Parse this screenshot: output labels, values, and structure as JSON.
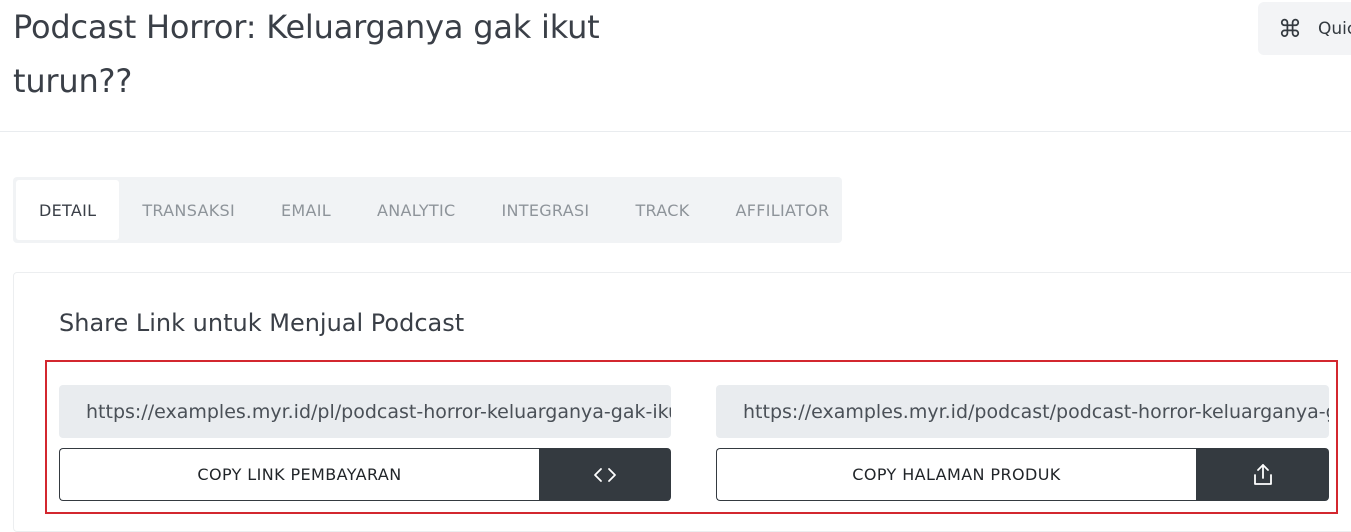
{
  "page": {
    "title": "Podcast Horror: Keluarganya gak ikut turun??"
  },
  "quick": {
    "label": "Quic",
    "icon": "command-icon"
  },
  "tabs": [
    {
      "label": "DETAIL",
      "active": true
    },
    {
      "label": "TRANSAKSI",
      "active": false
    },
    {
      "label": "EMAIL",
      "active": false
    },
    {
      "label": "ANALYTIC",
      "active": false
    },
    {
      "label": "INTEGRASI",
      "active": false
    },
    {
      "label": "TRACK",
      "active": false
    },
    {
      "label": "AFFILIATOR",
      "active": false
    }
  ],
  "share": {
    "title": "Share Link untuk Menjual Podcast",
    "payment_link": {
      "url": "https://examples.myr.id/pl/podcast-horror-keluarganya-gak-ikut-turun",
      "button_label": "COPY LINK PEMBAYARAN",
      "icon": "code-icon"
    },
    "product_page": {
      "url": "https://examples.myr.id/podcast/podcast-horror-keluarganya-gak-ikut-turun",
      "button_label": "COPY HALAMAN PRODUK",
      "icon": "share-icon"
    }
  },
  "colors": {
    "highlight": "#d3272f",
    "dark_button": "#343a40",
    "field_bg": "#e9ecef"
  }
}
